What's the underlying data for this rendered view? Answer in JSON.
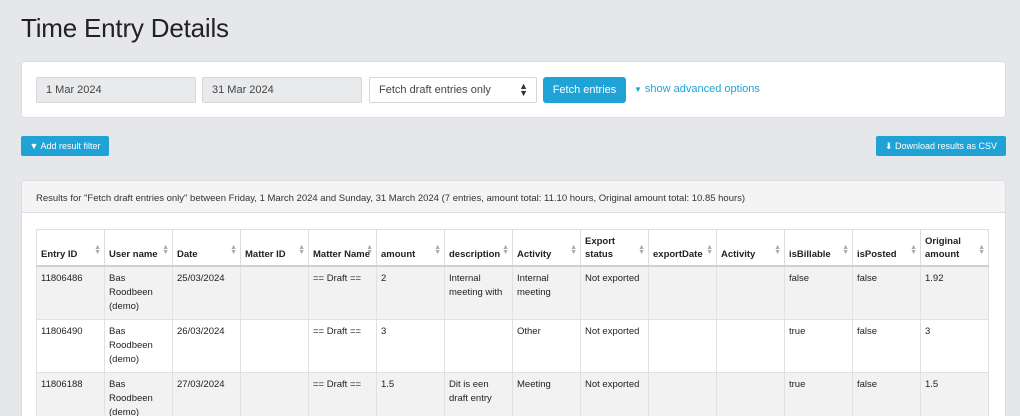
{
  "page": {
    "title": "Time Entry Details"
  },
  "filters": {
    "date_from": "1 Mar 2024",
    "date_to": "31 Mar 2024",
    "fetch_mode": "Fetch draft entries only",
    "fetch_button": "Fetch entries",
    "advanced_link": "show advanced options"
  },
  "actions": {
    "add_filter": "Add result filter",
    "download_csv": "Download results as CSV"
  },
  "results": {
    "summary": "Results for \"Fetch draft entries only\" between Friday, 1 March 2024 and Sunday, 31 March 2024 (7 entries, amount total: 11.10 hours, Original amount total: 10.85 hours)",
    "columns": [
      "Entry ID",
      "User name",
      "Date",
      "Matter ID",
      "Matter Name",
      "amount",
      "description",
      "Activity",
      "Export status",
      "exportDate",
      "Activity",
      "isBillable",
      "isPosted",
      "Original amount"
    ],
    "rows": [
      [
        "11806486",
        "Bas Roodbeen (demo)",
        "25/03/2024",
        "",
        "== Draft ==",
        "2",
        "Internal meeting with",
        "Internal meeting",
        "Not exported",
        "",
        "",
        "false",
        "false",
        "1.92"
      ],
      [
        "11806490",
        "Bas Roodbeen (demo)",
        "26/03/2024",
        "",
        "== Draft ==",
        "3",
        "",
        "Other",
        "Not exported",
        "",
        "",
        "true",
        "false",
        "3"
      ],
      [
        "11806188",
        "Bas Roodbeen (demo)",
        "27/03/2024",
        "",
        "== Draft ==",
        "1.5",
        "Dit is een draft entry",
        "Meeting",
        "Not exported",
        "",
        "",
        "true",
        "false",
        "1.5"
      ]
    ]
  },
  "colors": {
    "accent": "#1fa3d6",
    "background": "#e6e7ea"
  }
}
